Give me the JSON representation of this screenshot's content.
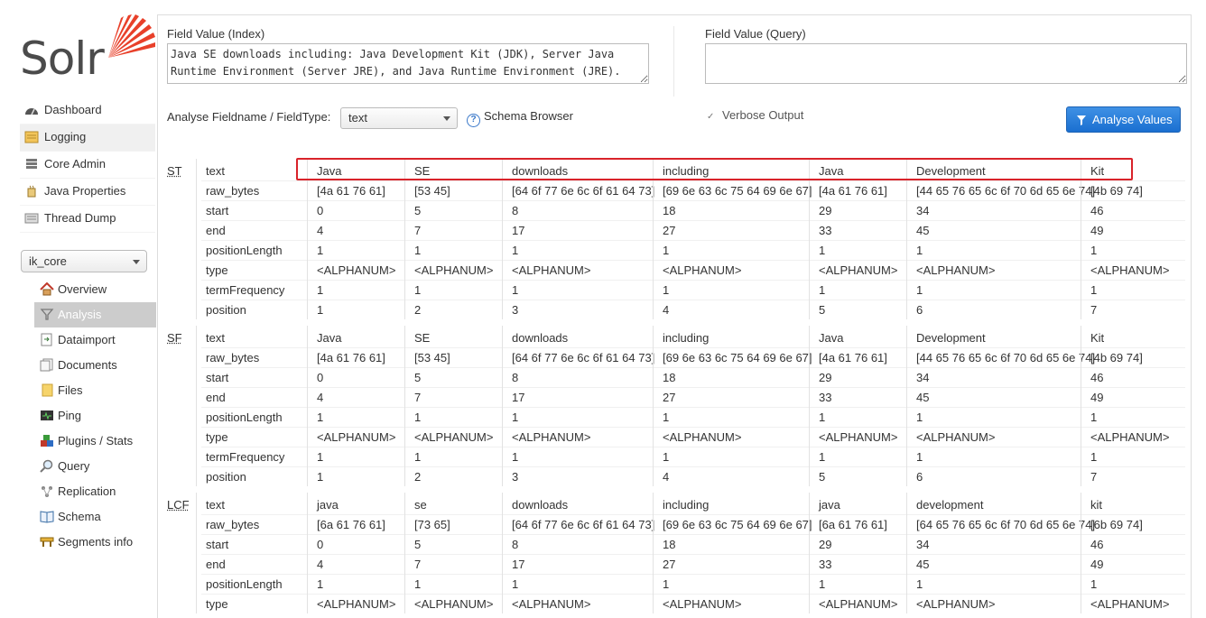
{
  "logo": {
    "text": "Solr"
  },
  "nav": [
    {
      "label": "Dashboard",
      "icon": "dashboard-icon"
    },
    {
      "label": "Logging",
      "icon": "logging-icon"
    },
    {
      "label": "Core Admin",
      "icon": "core-admin-icon"
    },
    {
      "label": "Java Properties",
      "icon": "java-properties-icon"
    },
    {
      "label": "Thread Dump",
      "icon": "thread-dump-icon"
    }
  ],
  "core_selector": {
    "value": "ik_core"
  },
  "core_nav": [
    {
      "label": "Overview",
      "icon": "home-icon"
    },
    {
      "label": "Analysis",
      "icon": "filter-icon"
    },
    {
      "label": "Dataimport",
      "icon": "dataimport-icon"
    },
    {
      "label": "Documents",
      "icon": "documents-icon"
    },
    {
      "label": "Files",
      "icon": "files-icon"
    },
    {
      "label": "Ping",
      "icon": "ping-icon"
    },
    {
      "label": "Plugins / Stats",
      "icon": "plugins-icon"
    },
    {
      "label": "Query",
      "icon": "query-icon"
    },
    {
      "label": "Replication",
      "icon": "replication-icon"
    },
    {
      "label": "Schema",
      "icon": "schema-icon"
    },
    {
      "label": "Segments info",
      "icon": "segments-icon"
    }
  ],
  "form": {
    "index_label": "Field Value (Index)",
    "index_value": "Java SE downloads including: Java Development Kit (JDK), Server Java Runtime Environment (Server JRE), and Java Runtime Environment (JRE).",
    "query_label": "Field Value (Query)",
    "query_value": "",
    "fieldtype_label": "Analyse Fieldname / FieldType:",
    "fieldtype_value": "text",
    "schema_browser": "Schema Browser",
    "verbose_label": "Verbose Output",
    "analyse_button": "Analyse Values"
  },
  "analysis": {
    "row_labels": [
      "text",
      "raw_bytes",
      "start",
      "end",
      "positionLength",
      "type",
      "termFrequency",
      "position"
    ],
    "stages": [
      {
        "abbr": "ST",
        "tokens": [
          [
            "Java",
            "[4a 61 76 61]",
            "0",
            "4",
            "1",
            "<ALPHANUM>",
            "1",
            "1"
          ],
          [
            "SE",
            "[53 45]",
            "5",
            "7",
            "1",
            "<ALPHANUM>",
            "1",
            "2"
          ],
          [
            "downloads",
            "[64 6f 77 6e 6c 6f 61 64 73]",
            "8",
            "17",
            "1",
            "<ALPHANUM>",
            "1",
            "3"
          ],
          [
            "including",
            "[69 6e 63 6c 75 64 69 6e 67]",
            "18",
            "27",
            "1",
            "<ALPHANUM>",
            "1",
            "4"
          ],
          [
            "Java",
            "[4a 61 76 61]",
            "29",
            "33",
            "1",
            "<ALPHANUM>",
            "1",
            "5"
          ],
          [
            "Development",
            "[44 65 76 65 6c 6f 70 6d 65 6e 74]",
            "34",
            "45",
            "1",
            "<ALPHANUM>",
            "1",
            "6"
          ],
          [
            "Kit",
            "[4b 69 74]",
            "46",
            "49",
            "1",
            "<ALPHANUM>",
            "1",
            "7"
          ]
        ]
      },
      {
        "abbr": "SF",
        "tokens": [
          [
            "Java",
            "[4a 61 76 61]",
            "0",
            "4",
            "1",
            "<ALPHANUM>",
            "1",
            "1"
          ],
          [
            "SE",
            "[53 45]",
            "5",
            "7",
            "1",
            "<ALPHANUM>",
            "1",
            "2"
          ],
          [
            "downloads",
            "[64 6f 77 6e 6c 6f 61 64 73]",
            "8",
            "17",
            "1",
            "<ALPHANUM>",
            "1",
            "3"
          ],
          [
            "including",
            "[69 6e 63 6c 75 64 69 6e 67]",
            "18",
            "27",
            "1",
            "<ALPHANUM>",
            "1",
            "4"
          ],
          [
            "Java",
            "[4a 61 76 61]",
            "29",
            "33",
            "1",
            "<ALPHANUM>",
            "1",
            "5"
          ],
          [
            "Development",
            "[44 65 76 65 6c 6f 70 6d 65 6e 74]",
            "34",
            "45",
            "1",
            "<ALPHANUM>",
            "1",
            "6"
          ],
          [
            "Kit",
            "[4b 69 74]",
            "46",
            "49",
            "1",
            "<ALPHANUM>",
            "1",
            "7"
          ]
        ]
      },
      {
        "abbr": "LCF",
        "tokens": [
          [
            "java",
            "[6a 61 76 61]",
            "0",
            "4",
            "1",
            "<ALPHANUM>"
          ],
          [
            "se",
            "[73 65]",
            "5",
            "7",
            "1",
            "<ALPHANUM>"
          ],
          [
            "downloads",
            "[64 6f 77 6e 6c 6f 61 64 73]",
            "8",
            "17",
            "1",
            "<ALPHANUM>"
          ],
          [
            "including",
            "[69 6e 63 6c 75 64 69 6e 67]",
            "18",
            "27",
            "1",
            "<ALPHANUM>"
          ],
          [
            "java",
            "[6a 61 76 61]",
            "29",
            "33",
            "1",
            "<ALPHANUM>"
          ],
          [
            "development",
            "[64 65 76 65 6c 6f 70 6d 65 6e 74]",
            "34",
            "45",
            "1",
            "<ALPHANUM>"
          ],
          [
            "kit",
            "[6b 69 74]",
            "46",
            "49",
            "1",
            "<ALPHANUM>"
          ]
        ]
      }
    ]
  },
  "colors": {
    "accent": "#1a6fd0",
    "highlight": "#d9232a",
    "logo_orange": "#e8402a"
  }
}
